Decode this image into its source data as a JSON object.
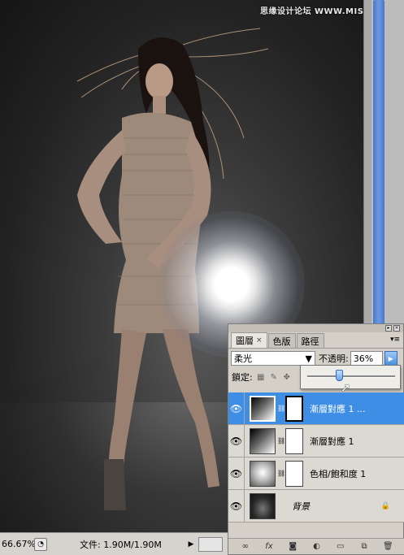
{
  "watermark": "思缘设计论坛 WWW.MISSYUAN.COM",
  "statusbar": {
    "zoom": "66.67%",
    "doc_info": "文件: 1.90M/1.90M"
  },
  "panel": {
    "tabs": [
      {
        "label": "圖層",
        "active": true
      },
      {
        "label": "色版",
        "active": false
      },
      {
        "label": "路徑",
        "active": false
      }
    ],
    "blend_mode": "柔光",
    "opacity_label": "不透明:",
    "opacity_value": "36%",
    "opacity_slider_fraction": 0.36,
    "lock_label": "鎖定:",
    "layers": [
      {
        "name": "漸層對應 1 ...",
        "selected": true,
        "thumb": "gradient-map",
        "has_mask": true
      },
      {
        "name": "漸層對應 1",
        "selected": false,
        "thumb": "gradient-map",
        "has_mask": true
      },
      {
        "name": "色相/飽和度 1",
        "selected": false,
        "thumb": "hue-saturation",
        "has_mask": true
      },
      {
        "name": "背景",
        "selected": false,
        "thumb": "photo",
        "has_mask": false,
        "locked": true
      }
    ],
    "bottom_icons": [
      "link-layers-icon",
      "fx-icon",
      "add-mask-icon",
      "adjustment-layer-icon",
      "new-group-icon",
      "new-layer-icon",
      "delete-layer-icon"
    ]
  },
  "colors": {
    "selection_blue": "#3f8ee6",
    "panel_bg": "#d4d0c8",
    "canvas_dark": "#222222"
  }
}
